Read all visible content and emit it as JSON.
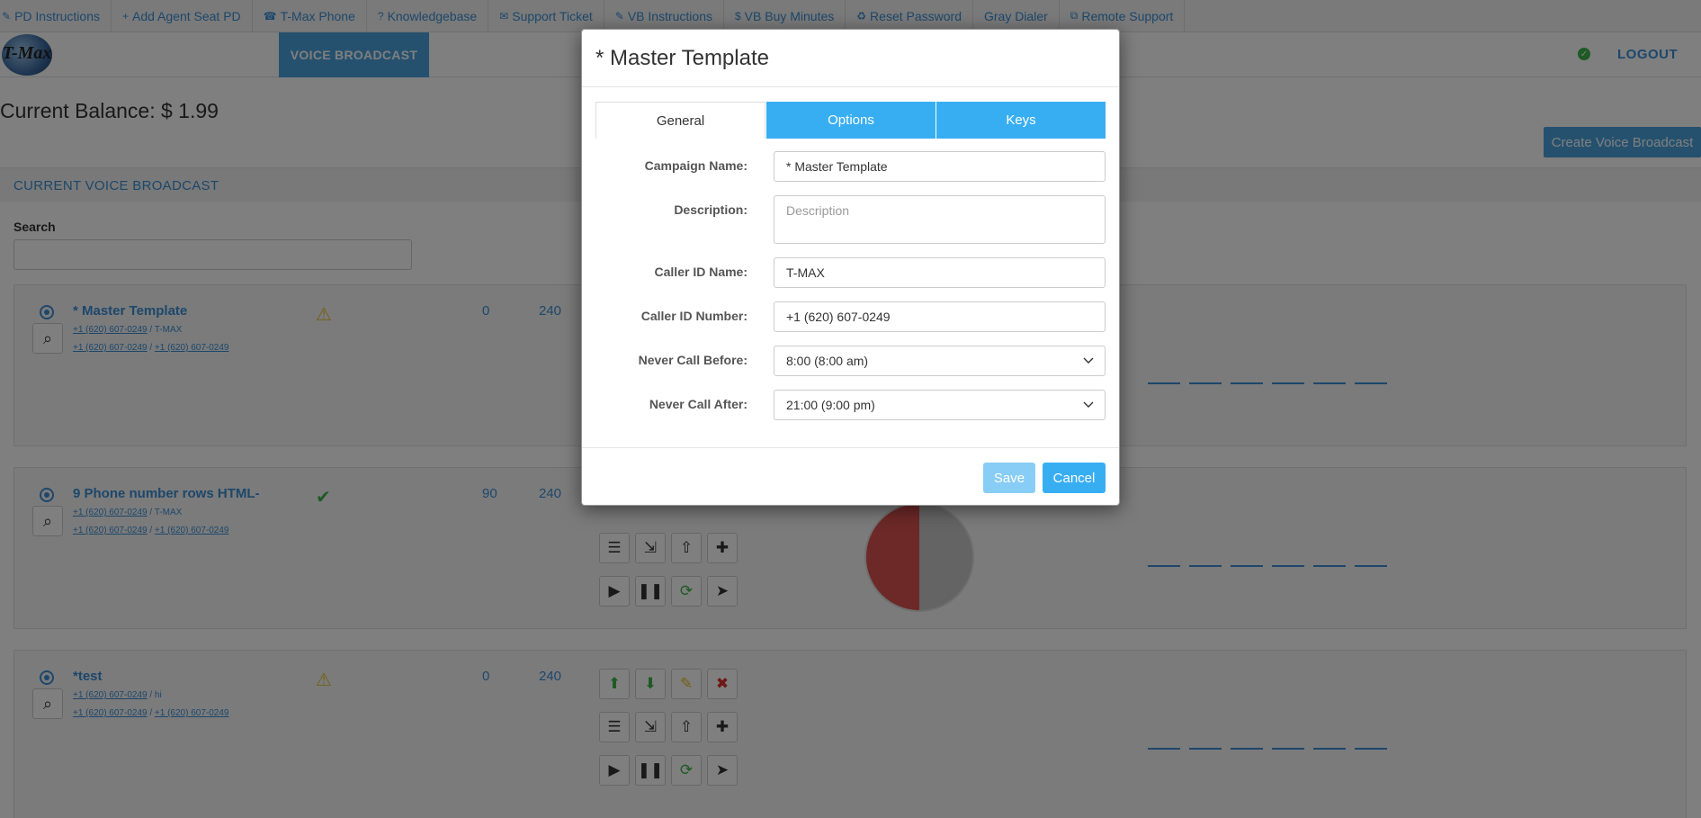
{
  "topbar": {
    "links": [
      {
        "icon": "wrench-icon",
        "glyph": "✎",
        "label": "PD Instructions"
      },
      {
        "icon": "plus-icon",
        "glyph": "+",
        "label": "Add Agent Seat PD"
      },
      {
        "icon": "phone-icon",
        "glyph": "☎",
        "label": "T-Max Phone"
      },
      {
        "icon": "question-icon",
        "glyph": "?",
        "label": "Knowledgebase"
      },
      {
        "icon": "envelope-icon",
        "glyph": "✉",
        "label": "Support Ticket"
      },
      {
        "icon": "wrench-icon",
        "glyph": "✎",
        "label": "VB Instructions"
      },
      {
        "icon": "dollar-icon",
        "glyph": "$",
        "label": "VB Buy Minutes"
      },
      {
        "icon": "recycle-icon",
        "glyph": "♻",
        "label": "Reset Password"
      },
      {
        "icon": "",
        "glyph": "",
        "label": "Gray Dialer"
      },
      {
        "icon": "remote-icon",
        "glyph": "⧉",
        "label": "Remote Support"
      }
    ]
  },
  "header": {
    "logo_text": "T-Max",
    "active_tab": "VOICE BROADCAST",
    "logout": "LOGOUT",
    "status_icon": "check-circle-icon"
  },
  "balance": "Current Balance: $ 1.99",
  "create_button": "Create Voice Broadcast",
  "section_title": "CURRENT VOICE BROADCAST",
  "search": {
    "label": "Search",
    "value": ""
  },
  "campaigns": [
    {
      "name": "* Master Template",
      "line1_num": "+1 (620) 607-0249",
      "line1_sep": " / ",
      "line1_name": "T-MAX",
      "line2_a": "+1 (620) 607-0249",
      "line2_sep": " / ",
      "line2_b": "+1 (620) 607-0249",
      "status": "warning",
      "col1": "0",
      "col2": "240"
    },
    {
      "name": "9 Phone number rows HTML-",
      "line1_num": "+1 (620) 607-0249",
      "line1_sep": " / ",
      "line1_name": "T-MAX",
      "line2_a": "+1 (620) 607-0249",
      "line2_sep": " / ",
      "line2_b": "+1 (620) 607-0249",
      "status": "ok",
      "col1": "90",
      "col2": "240"
    },
    {
      "name": "*test",
      "line1_num": "+1 (620) 607-0249",
      "line1_sep": " / ",
      "line1_name": "hi",
      "line2_a": "+1 (620) 607-0249",
      "line2_sep": " / ",
      "line2_b": "+1 (620) 607-0249",
      "status": "warning",
      "col1": "0",
      "col2": "240"
    }
  ],
  "modal": {
    "title": "* Master Template",
    "tabs": [
      "General",
      "Options",
      "Keys"
    ],
    "fields": {
      "campaign_name": {
        "label": "Campaign Name:",
        "value": "* Master Template"
      },
      "description": {
        "label": "Description:",
        "placeholder": "Description"
      },
      "caller_id_name": {
        "label": "Caller ID Name:",
        "value": "T-MAX"
      },
      "caller_id_number": {
        "label": "Caller ID Number:",
        "value": "+1 (620) 607-0249"
      },
      "never_call_before": {
        "label": "Never Call Before:",
        "value": "8:00 (8:00 am)"
      },
      "never_call_after": {
        "label": "Never Call After:",
        "value": "21:00 (9:00 pm)"
      }
    },
    "save": "Save",
    "cancel": "Cancel"
  },
  "colors": {
    "accent": "#3a8fd6",
    "tab_blue": "#38aef2",
    "warning": "#e6c229",
    "success": "#3cb54a",
    "danger": "#d9302c"
  }
}
